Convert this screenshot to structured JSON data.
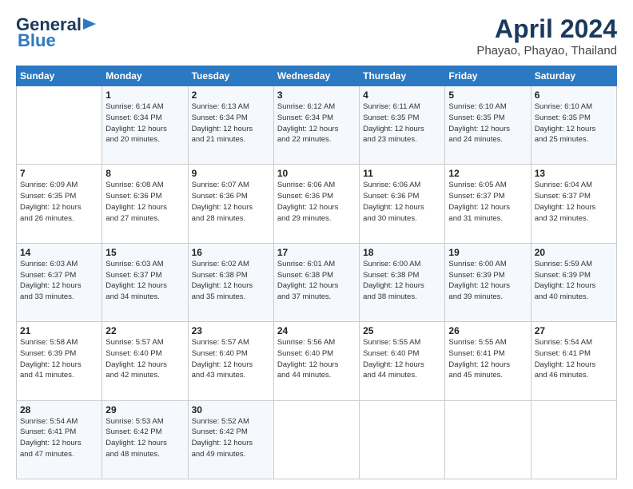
{
  "logo": {
    "line1": "General",
    "line2": "Blue"
  },
  "header": {
    "title": "April 2024",
    "location": "Phayao, Phayao, Thailand"
  },
  "weekdays": [
    "Sunday",
    "Monday",
    "Tuesday",
    "Wednesday",
    "Thursday",
    "Friday",
    "Saturday"
  ],
  "weeks": [
    [
      {
        "day": "",
        "info": ""
      },
      {
        "day": "1",
        "info": "Sunrise: 6:14 AM\nSunset: 6:34 PM\nDaylight: 12 hours\nand 20 minutes."
      },
      {
        "day": "2",
        "info": "Sunrise: 6:13 AM\nSunset: 6:34 PM\nDaylight: 12 hours\nand 21 minutes."
      },
      {
        "day": "3",
        "info": "Sunrise: 6:12 AM\nSunset: 6:34 PM\nDaylight: 12 hours\nand 22 minutes."
      },
      {
        "day": "4",
        "info": "Sunrise: 6:11 AM\nSunset: 6:35 PM\nDaylight: 12 hours\nand 23 minutes."
      },
      {
        "day": "5",
        "info": "Sunrise: 6:10 AM\nSunset: 6:35 PM\nDaylight: 12 hours\nand 24 minutes."
      },
      {
        "day": "6",
        "info": "Sunrise: 6:10 AM\nSunset: 6:35 PM\nDaylight: 12 hours\nand 25 minutes."
      }
    ],
    [
      {
        "day": "7",
        "info": "Sunrise: 6:09 AM\nSunset: 6:35 PM\nDaylight: 12 hours\nand 26 minutes."
      },
      {
        "day": "8",
        "info": "Sunrise: 6:08 AM\nSunset: 6:36 PM\nDaylight: 12 hours\nand 27 minutes."
      },
      {
        "day": "9",
        "info": "Sunrise: 6:07 AM\nSunset: 6:36 PM\nDaylight: 12 hours\nand 28 minutes."
      },
      {
        "day": "10",
        "info": "Sunrise: 6:06 AM\nSunset: 6:36 PM\nDaylight: 12 hours\nand 29 minutes."
      },
      {
        "day": "11",
        "info": "Sunrise: 6:06 AM\nSunset: 6:36 PM\nDaylight: 12 hours\nand 30 minutes."
      },
      {
        "day": "12",
        "info": "Sunrise: 6:05 AM\nSunset: 6:37 PM\nDaylight: 12 hours\nand 31 minutes."
      },
      {
        "day": "13",
        "info": "Sunrise: 6:04 AM\nSunset: 6:37 PM\nDaylight: 12 hours\nand 32 minutes."
      }
    ],
    [
      {
        "day": "14",
        "info": "Sunrise: 6:03 AM\nSunset: 6:37 PM\nDaylight: 12 hours\nand 33 minutes."
      },
      {
        "day": "15",
        "info": "Sunrise: 6:03 AM\nSunset: 6:37 PM\nDaylight: 12 hours\nand 34 minutes."
      },
      {
        "day": "16",
        "info": "Sunrise: 6:02 AM\nSunset: 6:38 PM\nDaylight: 12 hours\nand 35 minutes."
      },
      {
        "day": "17",
        "info": "Sunrise: 6:01 AM\nSunset: 6:38 PM\nDaylight: 12 hours\nand 37 minutes."
      },
      {
        "day": "18",
        "info": "Sunrise: 6:00 AM\nSunset: 6:38 PM\nDaylight: 12 hours\nand 38 minutes."
      },
      {
        "day": "19",
        "info": "Sunrise: 6:00 AM\nSunset: 6:39 PM\nDaylight: 12 hours\nand 39 minutes."
      },
      {
        "day": "20",
        "info": "Sunrise: 5:59 AM\nSunset: 6:39 PM\nDaylight: 12 hours\nand 40 minutes."
      }
    ],
    [
      {
        "day": "21",
        "info": "Sunrise: 5:58 AM\nSunset: 6:39 PM\nDaylight: 12 hours\nand 41 minutes."
      },
      {
        "day": "22",
        "info": "Sunrise: 5:57 AM\nSunset: 6:40 PM\nDaylight: 12 hours\nand 42 minutes."
      },
      {
        "day": "23",
        "info": "Sunrise: 5:57 AM\nSunset: 6:40 PM\nDaylight: 12 hours\nand 43 minutes."
      },
      {
        "day": "24",
        "info": "Sunrise: 5:56 AM\nSunset: 6:40 PM\nDaylight: 12 hours\nand 44 minutes."
      },
      {
        "day": "25",
        "info": "Sunrise: 5:55 AM\nSunset: 6:40 PM\nDaylight: 12 hours\nand 44 minutes."
      },
      {
        "day": "26",
        "info": "Sunrise: 5:55 AM\nSunset: 6:41 PM\nDaylight: 12 hours\nand 45 minutes."
      },
      {
        "day": "27",
        "info": "Sunrise: 5:54 AM\nSunset: 6:41 PM\nDaylight: 12 hours\nand 46 minutes."
      }
    ],
    [
      {
        "day": "28",
        "info": "Sunrise: 5:54 AM\nSunset: 6:41 PM\nDaylight: 12 hours\nand 47 minutes."
      },
      {
        "day": "29",
        "info": "Sunrise: 5:53 AM\nSunset: 6:42 PM\nDaylight: 12 hours\nand 48 minutes."
      },
      {
        "day": "30",
        "info": "Sunrise: 5:52 AM\nSunset: 6:42 PM\nDaylight: 12 hours\nand 49 minutes."
      },
      {
        "day": "",
        "info": ""
      },
      {
        "day": "",
        "info": ""
      },
      {
        "day": "",
        "info": ""
      },
      {
        "day": "",
        "info": ""
      }
    ]
  ]
}
